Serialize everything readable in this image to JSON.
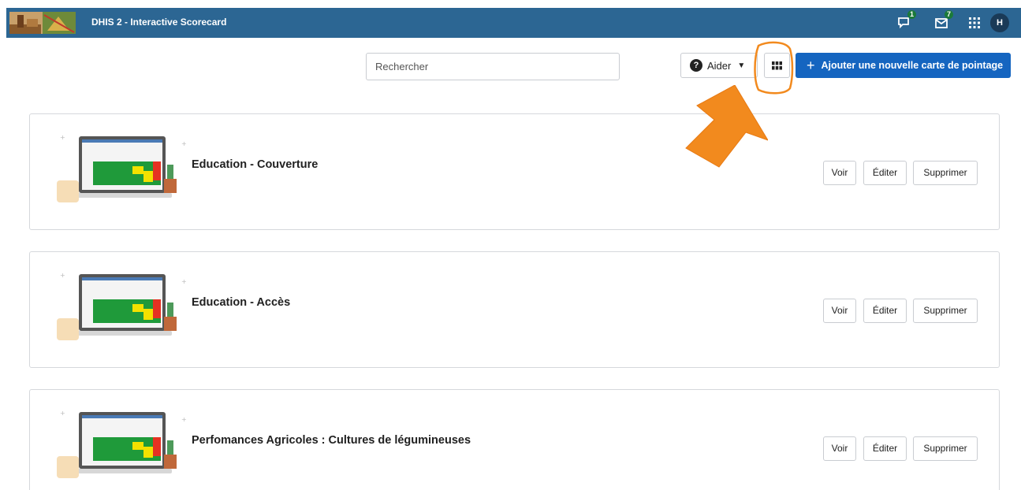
{
  "header": {
    "app_title": "DHIS 2 - Interactive Scorecard",
    "icons": [
      {
        "name": "interpretations-icon",
        "badge": "1"
      },
      {
        "name": "messages-icon",
        "badge": "7"
      },
      {
        "name": "apps-menu-icon"
      }
    ],
    "avatar_initial": "H",
    "color": "#2c6693"
  },
  "toolbar": {
    "search_placeholder": "Rechercher",
    "help_label": "Aider",
    "add_label": "Ajouter une nouvelle carte de pointage",
    "accent": "#1565c0"
  },
  "annotation": {
    "color": "#f28a1e"
  },
  "scorecards": [
    {
      "title": "Education - Couverture",
      "view": "Voir",
      "edit": "Éditer",
      "delete": "Supprimer"
    },
    {
      "title": "Education - Accès",
      "view": "Voir",
      "edit": "Éditer",
      "delete": "Supprimer"
    },
    {
      "title": "Perfomances Agricoles : Cultures de légumineuses",
      "view": "Voir",
      "edit": "Éditer",
      "delete": "Supprimer"
    }
  ]
}
